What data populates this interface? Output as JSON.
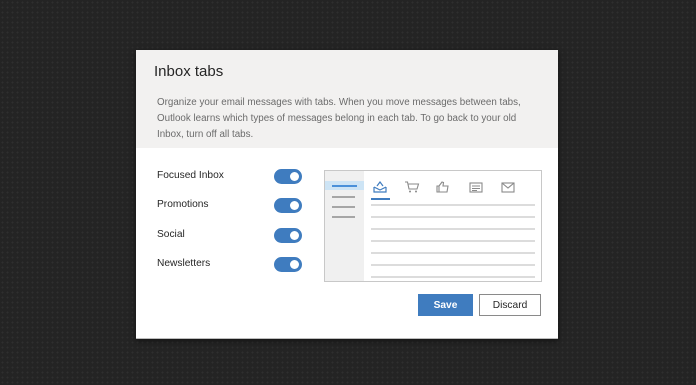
{
  "dialog": {
    "title": "Inbox tabs",
    "description": "Organize your email messages with tabs. When you move messages between tabs, Outlook learns which types of messages belong in each tab. To go back to your old Inbox, turn off all tabs."
  },
  "toggles": [
    {
      "label": "Focused Inbox",
      "state": "on"
    },
    {
      "label": "Promotions",
      "state": "on"
    },
    {
      "label": "Social",
      "state": "on"
    },
    {
      "label": "Newsletters",
      "state": "on"
    }
  ],
  "preview": {
    "tab_icons": [
      "inbox-icon",
      "cart-icon",
      "thumbs-up-icon",
      "newspaper-icon",
      "envelope-icon"
    ],
    "active_tab": "inbox-icon"
  },
  "buttons": {
    "save": "Save",
    "discard": "Discard"
  },
  "colors": {
    "accent": "#3f7cbf",
    "header_bg": "#f2f1f0",
    "backdrop": "#242424"
  }
}
